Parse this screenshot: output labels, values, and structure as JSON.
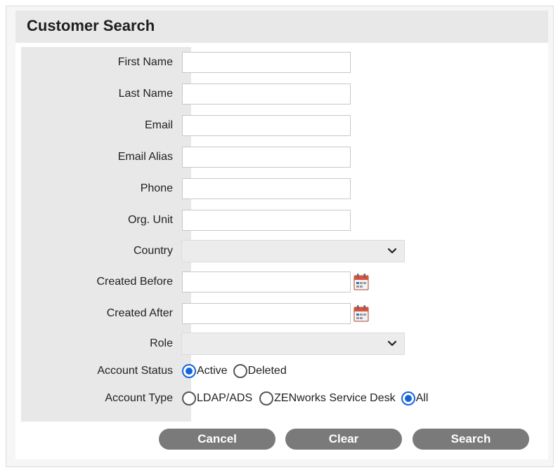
{
  "panel": {
    "title": "Customer Search"
  },
  "fields": {
    "first_name": {
      "label": "First Name",
      "value": ""
    },
    "last_name": {
      "label": "Last Name",
      "value": ""
    },
    "email": {
      "label": "Email",
      "value": ""
    },
    "email_alias": {
      "label": "Email Alias",
      "value": ""
    },
    "phone": {
      "label": "Phone",
      "value": ""
    },
    "org_unit": {
      "label": "Org. Unit",
      "value": ""
    },
    "country": {
      "label": "Country",
      "selected": ""
    },
    "created_before": {
      "label": "Created Before",
      "value": ""
    },
    "created_after": {
      "label": "Created After",
      "value": ""
    },
    "role": {
      "label": "Role",
      "selected": ""
    }
  },
  "account_status": {
    "label": "Account Status",
    "options": [
      {
        "label": "Active",
        "checked": true
      },
      {
        "label": "Deleted",
        "checked": false
      }
    ]
  },
  "account_type": {
    "label": "Account Type",
    "options": [
      {
        "label": "LDAP/ADS",
        "checked": false
      },
      {
        "label": "ZENworks Service Desk",
        "checked": false
      },
      {
        "label": "All",
        "checked": true
      }
    ]
  },
  "buttons": {
    "cancel": "Cancel",
    "clear": "Clear",
    "search": "Search"
  },
  "colors": {
    "radio_accent": "#1565d8",
    "button_bg": "#7a7a7a",
    "label_column_bg": "#e8e8e8"
  },
  "icons": {
    "date_picker": "calendar-icon",
    "dropdown": "chevron-down-icon"
  }
}
